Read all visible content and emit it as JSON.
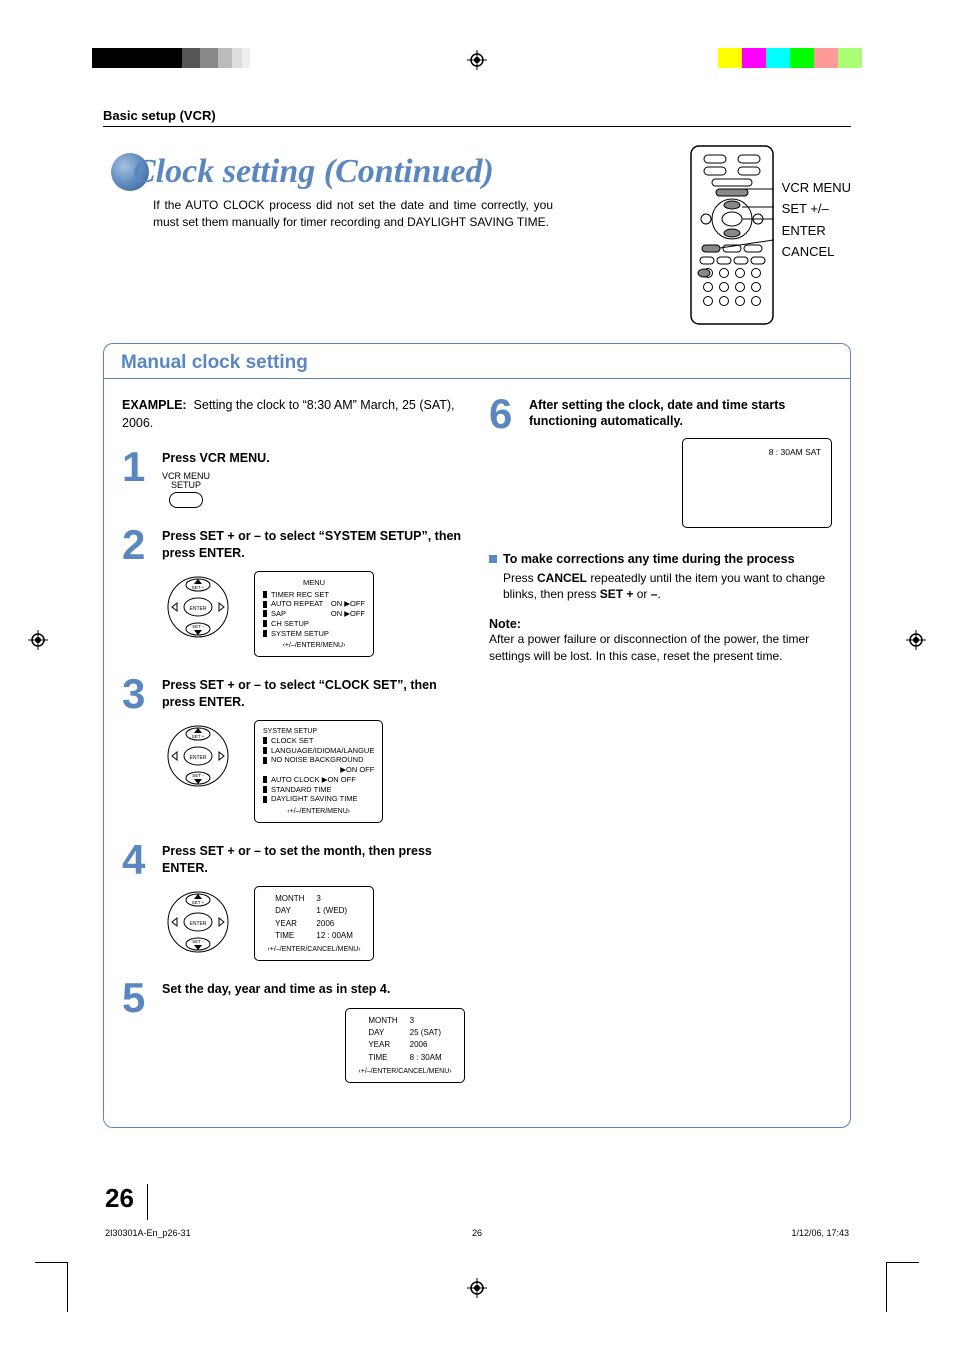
{
  "header": {
    "section": "Basic setup (VCR)"
  },
  "title": "Clock setting (Continued)",
  "intro": "If the AUTO CLOCK process did not set the date and time correctly, you must set them manually for timer recording and DAYLIGHT SAVING TIME.",
  "remote_labels": {
    "l1": "VCR MENU",
    "l2": "SET +/–",
    "l3": "ENTER",
    "l4": "CANCEL"
  },
  "section_title": "Manual clock setting",
  "example": {
    "label": "EXAMPLE:",
    "text": "Setting the clock to “8:30 AM” March, 25 (SAT), 2006."
  },
  "steps": {
    "s1": {
      "num": "1",
      "instr": "Press VCR MENU.",
      "btn_top": "VCR MENU",
      "btn_bottom": "SETUP"
    },
    "s2": {
      "num": "2",
      "instr": "Press SET + or – to select “SYSTEM SETUP”, then press ENTER.",
      "osd": {
        "title": "MENU",
        "rows": [
          {
            "cursor": true,
            "label": "TIMER REC SET",
            "right": ""
          },
          {
            "cursor": true,
            "label": "AUTO REPEAT",
            "right": "ON ▶OFF"
          },
          {
            "cursor": true,
            "label": "SAP",
            "right": "ON ▶OFF"
          },
          {
            "cursor": true,
            "label": "CH SETUP",
            "right": ""
          },
          {
            "cursor": true,
            "label": "SYSTEM SETUP",
            "right": ""
          }
        ],
        "footer": "‹+/–/ENTER/MENU›"
      }
    },
    "s3": {
      "num": "3",
      "instr": "Press SET + or – to select “CLOCK SET”, then press ENTER.",
      "osd": {
        "title": "SYSTEM SETUP",
        "rows": [
          {
            "label": "CLOCK SET"
          },
          {
            "label": "LANGUAGE/IDIOMA/LANGUE"
          },
          {
            "label": "NO NOISE BACKGROUND"
          },
          {
            "label_right": "▶ON   OFF"
          },
          {
            "label": "AUTO CLOCK  ▶ON   OFF"
          },
          {
            "label": "STANDARD TIME"
          },
          {
            "label": "DAYLIGHT SAVING TIME"
          }
        ],
        "footer": "‹+/–/ENTER/MENU›"
      }
    },
    "s4": {
      "num": "4",
      "instr": "Press SET + or – to set the month, then press ENTER.",
      "osd": {
        "rows": [
          {
            "k": "MONTH",
            "v": "3"
          },
          {
            "k": "DAY",
            "v": "1 (WED)"
          },
          {
            "k": "YEAR",
            "v": "2006"
          },
          {
            "k": "TIME",
            "v": "12 : 00AM"
          }
        ],
        "footer": "‹+/–/ENTER/CANCEL/MENU›"
      }
    },
    "s5": {
      "num": "5",
      "instr": "Set the day, year and time as in step 4.",
      "osd": {
        "rows": [
          {
            "k": "MONTH",
            "v": "3"
          },
          {
            "k": "DAY",
            "v": "25 (SAT)"
          },
          {
            "k": "YEAR",
            "v": "2006"
          },
          {
            "k": "TIME",
            "v": "8 : 30AM"
          }
        ],
        "footer": "‹+/–/ENTER/CANCEL/MENU›"
      }
    },
    "s6": {
      "num": "6",
      "instr": "After setting the clock, date and time starts functioning automatically.",
      "screen": "8 : 30AM  SAT"
    }
  },
  "corrections": {
    "heading": "To make corrections any time during the process",
    "body_pre": "Press ",
    "body_cancel": "CANCEL",
    "body_mid": " repeatedly until the item you want to change blinks, then press ",
    "body_set": "SET +",
    "body_or": " or ",
    "body_minus": "–",
    "body_end": "."
  },
  "note": {
    "head": "Note:",
    "body": "After a power failure or disconnection of the power, the timer settings will be lost. In this case, reset the present time."
  },
  "page_number": "26",
  "footer": {
    "file": "2I30301A-En_p26-31",
    "page": "26",
    "date": "1/12/06, 17:43"
  },
  "nav_pad": {
    "set_plus": "SET +",
    "set_minus": "SET –",
    "enter": "ENTER"
  },
  "colors": {
    "blue": "#5a87bf",
    "strip_left": [
      "#000",
      "#000",
      "#000",
      "#000",
      "#000",
      "#aaa",
      "#ccc",
      "#eee"
    ],
    "strip_right": [
      "#ff0",
      "#f0f",
      "#0ff",
      "#0f0",
      "#f00",
      "#00f",
      "#f77",
      "#af7"
    ]
  }
}
